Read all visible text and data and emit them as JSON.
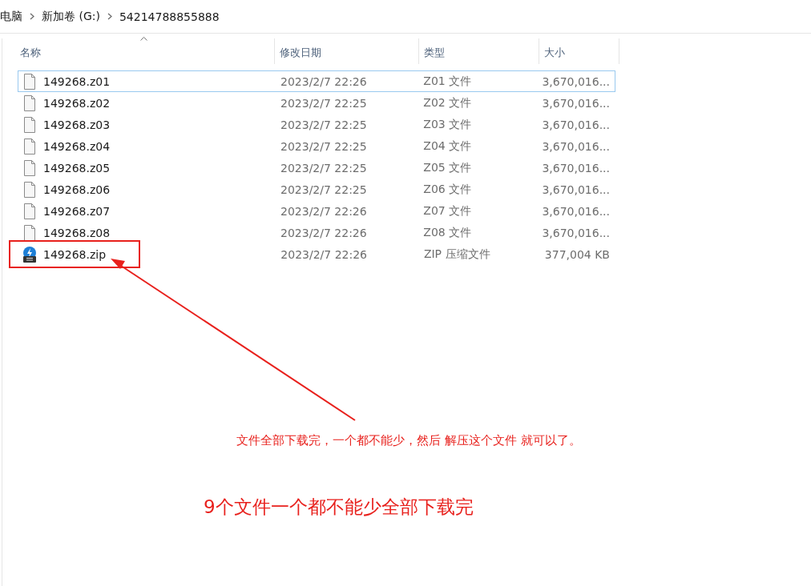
{
  "breadcrumb": [
    "电脑",
    "新加卷 (G:)",
    "54214788855888"
  ],
  "table": {
    "columns": [
      {
        "label": "名称",
        "sorted": true
      },
      {
        "label": "修改日期",
        "sorted": false
      },
      {
        "label": "类型",
        "sorted": false
      },
      {
        "label": "大小",
        "sorted": false
      }
    ],
    "rows": [
      {
        "kind": "file",
        "name": "149268.z01",
        "date": "2023/2/7 22:26",
        "type": "Z01 文件",
        "size": "3,670,016...",
        "focused": true,
        "highlighted": false
      },
      {
        "kind": "file",
        "name": "149268.z02",
        "date": "2023/2/7 22:25",
        "type": "Z02 文件",
        "size": "3,670,016...",
        "focused": false,
        "highlighted": false
      },
      {
        "kind": "file",
        "name": "149268.z03",
        "date": "2023/2/7 22:25",
        "type": "Z03 文件",
        "size": "3,670,016...",
        "focused": false,
        "highlighted": false
      },
      {
        "kind": "file",
        "name": "149268.z04",
        "date": "2023/2/7 22:25",
        "type": "Z04 文件",
        "size": "3,670,016...",
        "focused": false,
        "highlighted": false
      },
      {
        "kind": "file",
        "name": "149268.z05",
        "date": "2023/2/7 22:25",
        "type": "Z05 文件",
        "size": "3,670,016...",
        "focused": false,
        "highlighted": false
      },
      {
        "kind": "file",
        "name": "149268.z06",
        "date": "2023/2/7 22:25",
        "type": "Z06 文件",
        "size": "3,670,016...",
        "focused": false,
        "highlighted": false
      },
      {
        "kind": "file",
        "name": "149268.z07",
        "date": "2023/2/7 22:26",
        "type": "Z07 文件",
        "size": "3,670,016...",
        "focused": false,
        "highlighted": false
      },
      {
        "kind": "file",
        "name": "149268.z08",
        "date": "2023/2/7 22:26",
        "type": "Z08 文件",
        "size": "3,670,016...",
        "focused": false,
        "highlighted": false
      },
      {
        "kind": "zip",
        "name": "149268.zip",
        "date": "2023/2/7 22:26",
        "type": "ZIP 压缩文件",
        "size": "377,004 KB",
        "focused": false,
        "highlighted": true
      }
    ]
  },
  "annotations": [
    {
      "text": "文件全部下载完，一个都不能少，然后 解压这个文件 就可以了。",
      "kind": "small"
    },
    {
      "text": "9个文件一个都不能少全部下载完",
      "kind": "large"
    }
  ]
}
